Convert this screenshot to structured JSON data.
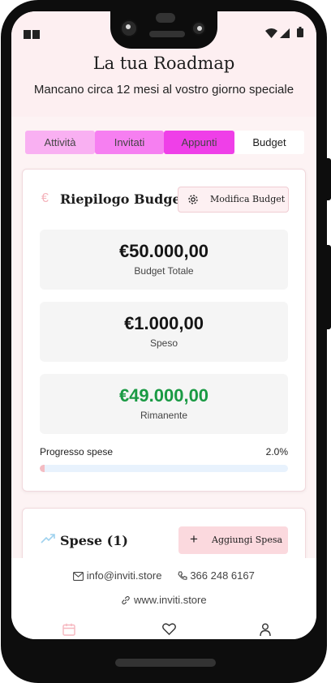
{
  "header": {
    "title": "La tua Roadmap",
    "subtitle": "Mancano circa 12 mesi al vostro giorno speciale"
  },
  "tabs": [
    {
      "label": "Attività",
      "bg": "#f9b0f2"
    },
    {
      "label": "Invitati",
      "bg": "#f67ff1"
    },
    {
      "label": "Appunti",
      "bg": "#ef3fe8"
    },
    {
      "label": "Budget",
      "bg": "#ffffff",
      "active": true
    }
  ],
  "budget_summary": {
    "currency_icon": "€",
    "title": "Riepilogo Budget",
    "edit_button_label": "Modifica Budget",
    "total": {
      "value": "€50.000,00",
      "label": "Budget Totale"
    },
    "spent": {
      "value": "€1.000,00",
      "label": "Speso"
    },
    "remaining": {
      "value": "€49.000,00",
      "label": "Rimanente",
      "color": "#1a9a44"
    },
    "progress": {
      "label": "Progresso spese",
      "value_text": "2.0%",
      "fraction": 0.02
    }
  },
  "expenses": {
    "title": "Spese (1)",
    "add_button_label": "Aggiungi Spesa"
  },
  "footer": {
    "email": "info@inviti.store",
    "phone": "366 248 6167",
    "website": "www.inviti.store"
  },
  "colors": {
    "accent_pink": "#f37bef",
    "background_pink": "#fdeff1",
    "progress_track": "#e8f2fd",
    "progress_fill": "#f4bcc2",
    "remaining_green": "#1a9a44"
  }
}
